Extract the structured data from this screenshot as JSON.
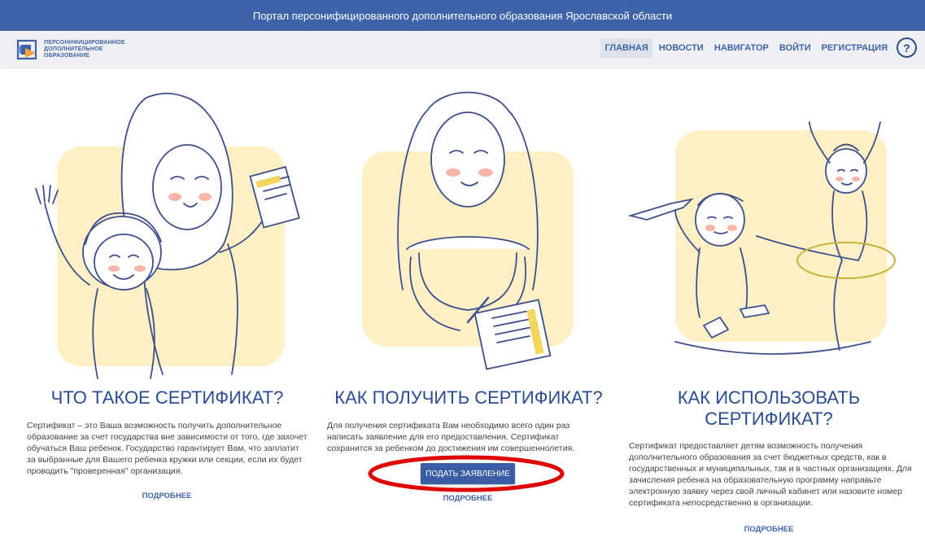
{
  "topbar": {
    "title": "Портал персонифицированного дополнительного образования Ярославской области"
  },
  "logo": {
    "line1": "ПЕРСОНИФИЦИРОВАННОЕ",
    "line2": "ДОПОЛНИТЕЛЬНОЕ",
    "line3": "ОБРАЗОВАНИЕ"
  },
  "nav": {
    "items": [
      "ГЛАВНАЯ",
      "НОВОСТИ",
      "НАВИГАТОР",
      "ВОЙТИ",
      "РЕГИСТРАЦИЯ"
    ],
    "help": "?"
  },
  "columns": [
    {
      "title": "ЧТО ТАКОЕ СЕРТИФИКАТ?",
      "text": "Сертификат – это Ваша возможность получить дополнительное образование за счет государства вне зависимости от того, где захочет обучаться Ваш ребенок. Государство гарантирует Вам, что заплатит за выбранные для Вашего ребенка кружки или секции, если их будет проводить \"проверенная\" организация.",
      "more": "ПОДРОБНЕЕ"
    },
    {
      "title": "КАК ПОЛУЧИТЬ СЕРТИФИКАТ?",
      "text": "Для получения сертификата Вам необходимо всего один раз написать заявление для его предоставления. Сертификат сохранится за ребенком до достижения им совершеннолетия.",
      "button": "ПОДАТЬ ЗАЯВЛЕНИЕ",
      "more": "ПОДРОБНЕЕ"
    },
    {
      "title": "КАК ИСПОЛЬЗОВАТЬ СЕРТИФИКАТ?",
      "text": "Сертификат предоставляет детям возможность получения дополнительного образования за счет бюджетных средств, как в государственных и муниципальных, так и в частных организациях. Для зачисления ребенка на образовательную программу направьте электронную заявку через свой личный кабинет или назовите номер сертификата непосредственно в организации.",
      "more": "ПОДРОБНЕЕ"
    }
  ],
  "colors": {
    "brand": "#3f63a8",
    "heading": "#2a4c92",
    "illustration_bg": "#fdf0c4",
    "annotation": "#e00000"
  },
  "icons": {
    "logo": "logo-mark-icon",
    "help": "help-icon"
  }
}
